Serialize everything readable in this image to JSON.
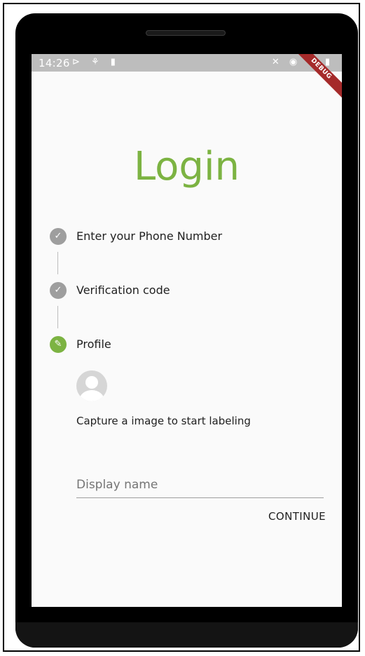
{
  "status_bar": {
    "time": "14:26",
    "left_icons": "⊳ ⚘ ▮",
    "right_icons": "✕ ◉ ◠ ▮",
    "ribbon": "DEBUG"
  },
  "page": {
    "title": "Login"
  },
  "stepper": {
    "steps": [
      {
        "label": "Enter your Phone Number",
        "state": "completed",
        "icon": "check-icon"
      },
      {
        "label": "Verification code",
        "state": "completed",
        "icon": "check-icon"
      },
      {
        "label": "Profile",
        "state": "editing",
        "icon": "pencil-icon"
      }
    ]
  },
  "profile": {
    "caption": "Capture a image to start labeling",
    "display_name": {
      "value": "",
      "placeholder": "Display name"
    },
    "continue_label": "CONTINUE"
  },
  "colors": {
    "accent": "#7cb342",
    "inactive_step": "#9e9e9e",
    "status_bar": "#bdbdbd",
    "debug_ribbon": "#a52a2a"
  }
}
